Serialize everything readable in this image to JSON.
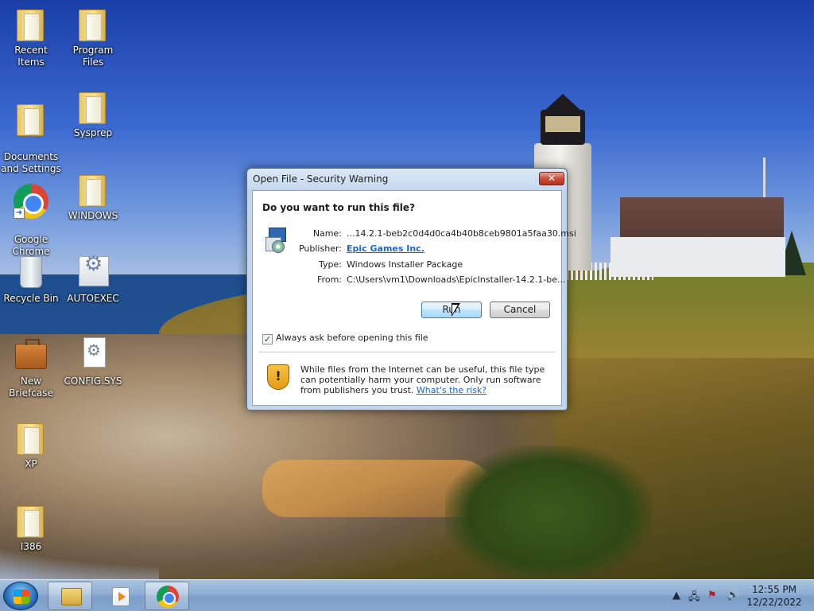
{
  "desktop_icons": [
    {
      "label": "Recent Items",
      "icon": "folder-icon"
    },
    {
      "label": "Program Files",
      "icon": "folder-icon"
    },
    {
      "label": "Documents\nand Settings",
      "icon": "folder-icon"
    },
    {
      "label": "Sysprep",
      "icon": "folder-icon"
    },
    {
      "label": "Google\nChrome",
      "icon": "chrome-icon"
    },
    {
      "label": "WINDOWS",
      "icon": "folder-icon"
    },
    {
      "label": "Recycle Bin",
      "icon": "recycle-bin-icon"
    },
    {
      "label": "AUTOEXEC",
      "icon": "system-file-icon"
    },
    {
      "label": "New Briefcase",
      "icon": "briefcase-icon"
    },
    {
      "label": "CONFIG.SYS",
      "icon": "system-file-icon"
    },
    {
      "label": "XP",
      "icon": "folder-icon"
    },
    {
      "label": "I386",
      "icon": "folder-icon"
    }
  ],
  "dialog": {
    "title": "Open File - Security Warning",
    "close_label": "✕",
    "question": "Do you want to run this file?",
    "fields": [
      {
        "label": "Name:",
        "value": "...14.2.1-beb2c0d4d0ca4b40b8ceb9801a5faa30.msi",
        "link": false
      },
      {
        "label": "Publisher:",
        "value": "Epic Games Inc.",
        "link": true
      },
      {
        "label": "Type:",
        "value": "Windows Installer Package",
        "link": false
      },
      {
        "label": "From:",
        "value": "C:\\Users\\vm1\\Downloads\\EpicInstaller-14.2.1-be...",
        "link": false
      }
    ],
    "run_label": "Run",
    "cancel_label": "Cancel",
    "always_ask_label": "Always ask before opening this file",
    "always_ask_checked": true,
    "warning_text": "While files from the Internet can be useful, this file type can potentially harm your computer. Only run software from publishers you trust.",
    "risk_link": "What's the risk?"
  },
  "taskbar": {
    "pinned": [
      "windows-explorer-icon",
      "media-player-icon",
      "chrome-icon"
    ],
    "tray_icons": [
      "show-hidden-icons-chevron",
      "network-icon",
      "action-center-icon",
      "volume-icon"
    ],
    "time": "12:55 PM",
    "date": "12/22/2022"
  },
  "colors": {
    "link": "#1e64c8",
    "dialog_frame": "#c3d6ec",
    "close_button": "#cc4e3a"
  }
}
